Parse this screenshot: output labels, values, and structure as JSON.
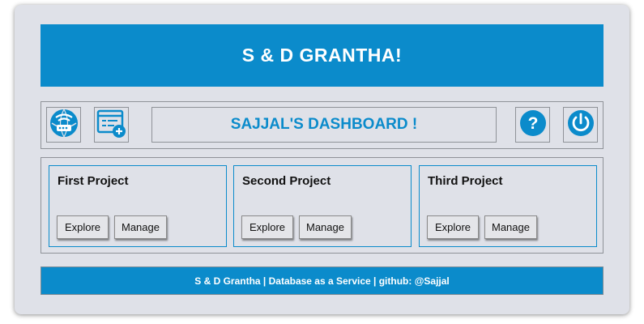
{
  "header": {
    "title": "S & D GRANTHA!"
  },
  "toolbar": {
    "left_buttons": [
      {
        "icon": "database-network-icon"
      },
      {
        "icon": "add-database-icon"
      }
    ],
    "dashboard_title": "SAJJAL'S DASHBOARD !",
    "right_buttons": [
      {
        "icon": "help-icon"
      },
      {
        "icon": "power-icon"
      }
    ]
  },
  "projects": [
    {
      "title": "First Project",
      "explore_label": "Explore",
      "manage_label": "Manage"
    },
    {
      "title": "Second Project",
      "explore_label": "Explore",
      "manage_label": "Manage"
    },
    {
      "title": "Third Project",
      "explore_label": "Explore",
      "manage_label": "Manage"
    }
  ],
  "footer": {
    "text": "S & D Grantha | Database as a Service | github: @Sajjal"
  },
  "colors": {
    "accent": "#0b8bcb",
    "background": "#dfe1e8",
    "border": "#8f9298"
  }
}
